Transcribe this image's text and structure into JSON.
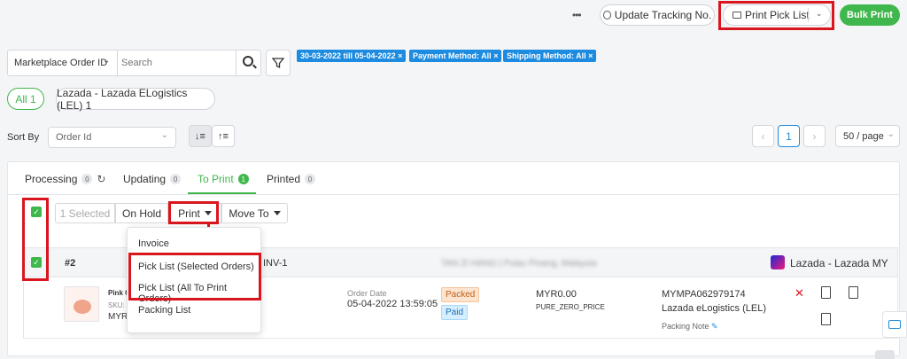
{
  "topbar": {
    "more_label": "•••",
    "update_tracking_label": "Update Tracking No.",
    "print_pick_list_label": "Print Pick List",
    "bulk_print_label": "Bulk Print"
  },
  "search": {
    "field_select": "Marketplace Order ID",
    "placeholder": "Search"
  },
  "filter_chips": [
    "30-03-2022 till 05-04-2022",
    "Payment Method: All",
    "Shipping Method: All"
  ],
  "channel_pills": [
    {
      "label": "All 1"
    },
    {
      "label": "Lazada - Lazada ELogistics (LEL) 1"
    }
  ],
  "sort": {
    "label": "Sort By",
    "value": "Order Id"
  },
  "pagination": {
    "current_page": "1",
    "per_page": "50 / page"
  },
  "status_tabs": [
    {
      "label": "Processing",
      "count": "0"
    },
    {
      "label": "Updating",
      "count": "0"
    },
    {
      "label": "To Print",
      "count": "1"
    },
    {
      "label": "Printed",
      "count": "0"
    }
  ],
  "actions": {
    "selected": "1 Selected",
    "on_hold": "On Hold",
    "print": "Print",
    "move_to": "Move To"
  },
  "print_menu": {
    "items": [
      "Invoice",
      "Pick List (Selected Orders)",
      "Pick List (All To Print Orders)",
      "Packing List"
    ]
  },
  "order": {
    "number": "#2",
    "invoice": "INV-1",
    "customer_blurred": "TAN ZI HANG | Pulau Pinang, Malaysia",
    "marketplace": "Lazada - Lazada MY",
    "product_name": "Pink C",
    "sku_label": "SKU:",
    "price_short": "MYR",
    "order_date_label": "Order Date",
    "order_date": "05-04-2022 13:59:05",
    "status_packed": "Packed",
    "status_paid": "Paid",
    "amount": "MYR0.00",
    "payment_code": "PURE_ZERO_PRICE",
    "tracking": "MYMPA062979174",
    "shipping": "Lazada eLogistics (LEL)",
    "packing_note": "Packing Note"
  },
  "colors": {
    "accent_green": "#3fb74c",
    "chip_blue": "#1d8be0",
    "highlight_red": "#d9161e"
  }
}
